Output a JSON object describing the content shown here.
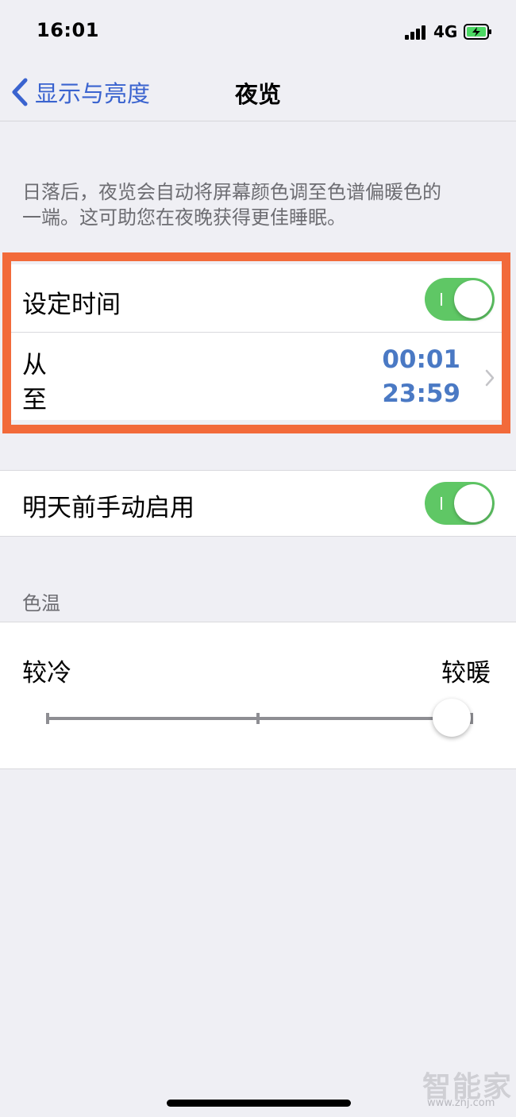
{
  "status_bar": {
    "time": "16:01",
    "network": "4G",
    "battery_color": "#4cd964"
  },
  "nav": {
    "back_label": "显示与亮度",
    "title": "夜览"
  },
  "description": {
    "line1": "日落后，夜览会自动将屏幕颜色调至色谱偏暖色的",
    "line2": "一端。这可助您在夜晚获得更佳睡眠。"
  },
  "schedule": {
    "label": "设定时间",
    "enabled": true,
    "from_label": "从",
    "to_label": "至",
    "from_time": "00:01",
    "to_time": "23:59"
  },
  "manual": {
    "label": "明天前手动启用",
    "enabled": true
  },
  "color_temp": {
    "section_header": "色温",
    "cool_label": "较冷",
    "warm_label": "较暖",
    "level": 0.97
  },
  "watermark": {
    "logo": "智能家",
    "url": "www.znj.com"
  },
  "colors": {
    "accent_blue": "#3a63cf",
    "toggle_green": "#5fc765",
    "highlight_orange": "#f26a3a",
    "time_blue": "#4a79c4"
  }
}
